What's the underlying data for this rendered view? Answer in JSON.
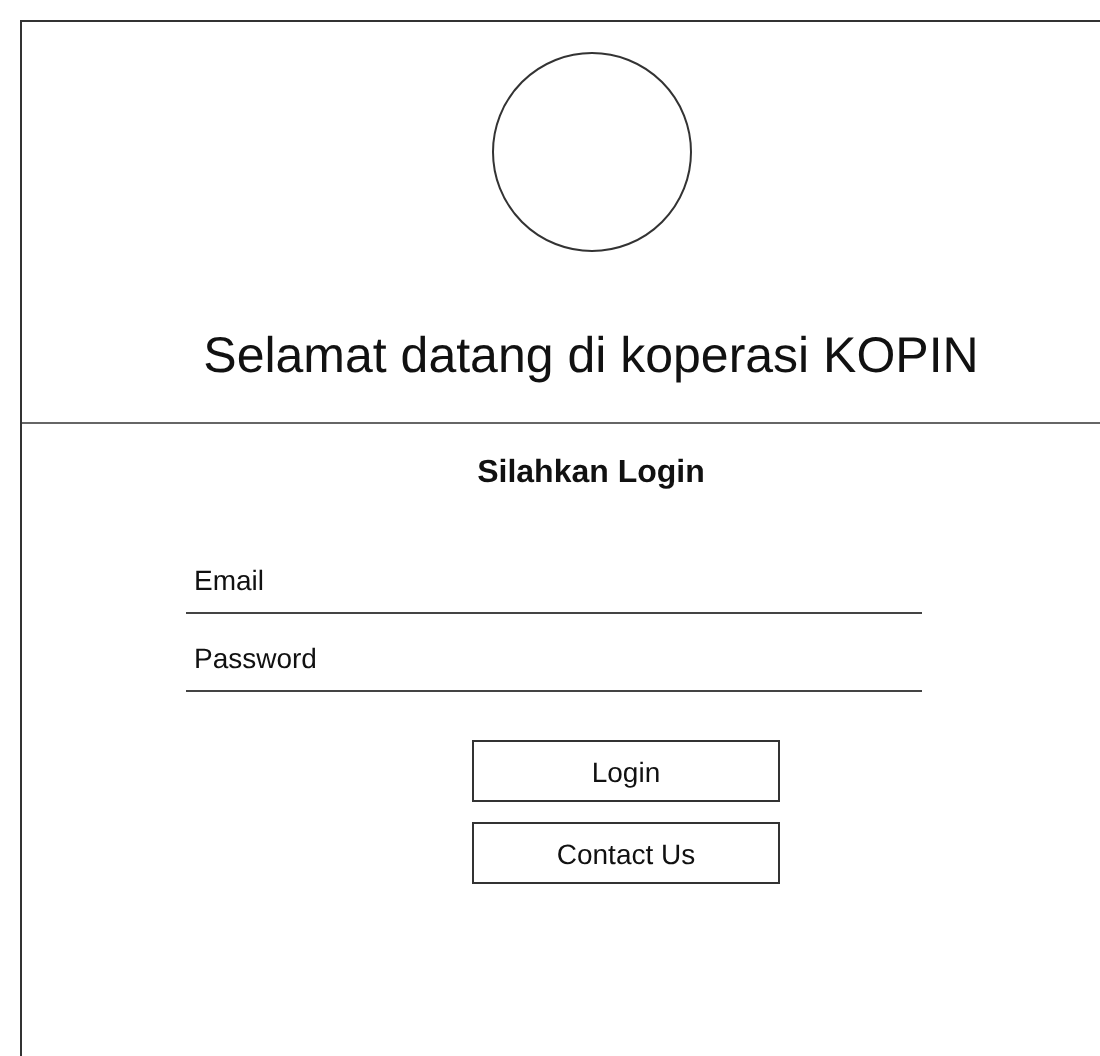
{
  "logo": {
    "kind": "circle"
  },
  "title": "Selamat datang di koperasi KOPIN",
  "login_heading": "Silahkan Login",
  "fields": [
    {
      "placeholder": "Email"
    },
    {
      "placeholder": "Password"
    }
  ],
  "buttons": [
    "Login",
    "Contact Us"
  ]
}
